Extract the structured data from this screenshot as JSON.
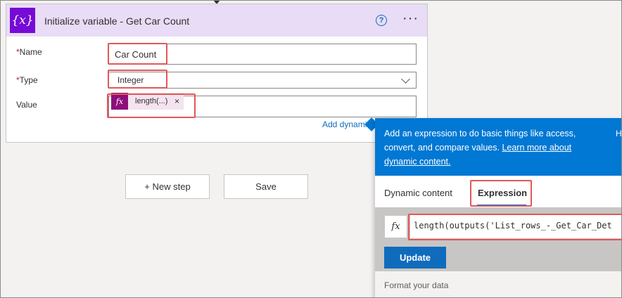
{
  "card": {
    "title": "Initialize variable - Get Car Count",
    "icon": "variable-icon",
    "help_symbol": "?",
    "more_symbol": "···",
    "fields": {
      "name": {
        "label": "Name",
        "value": "Car Count",
        "required": true
      },
      "type": {
        "label": "Type",
        "value": "Integer",
        "required": true
      },
      "value": {
        "label": "Value",
        "token_text": "length(...)",
        "token_remove": "×"
      }
    },
    "add_dynamic_link": "Add dynamic"
  },
  "buttons": {
    "new_step": "+ New step",
    "save": "Save"
  },
  "popup": {
    "info_text": "Add an expression to do basic things like access, convert, and compare values. ",
    "info_link": "Learn more about dynamic content.",
    "info_cutoff": "H",
    "tabs": [
      "Dynamic content",
      "Expression"
    ],
    "active_tab": "Expression",
    "fx_label": "fx",
    "expression": "length(outputs('List_rows_-_Get_Car_Det",
    "update_label": "Update",
    "format_label": "Format your data"
  },
  "colors": {
    "accent": "#0078d4",
    "variable_icon": "#770bd6",
    "token_fx": "#8e0f7a",
    "highlight": "#e35656"
  }
}
